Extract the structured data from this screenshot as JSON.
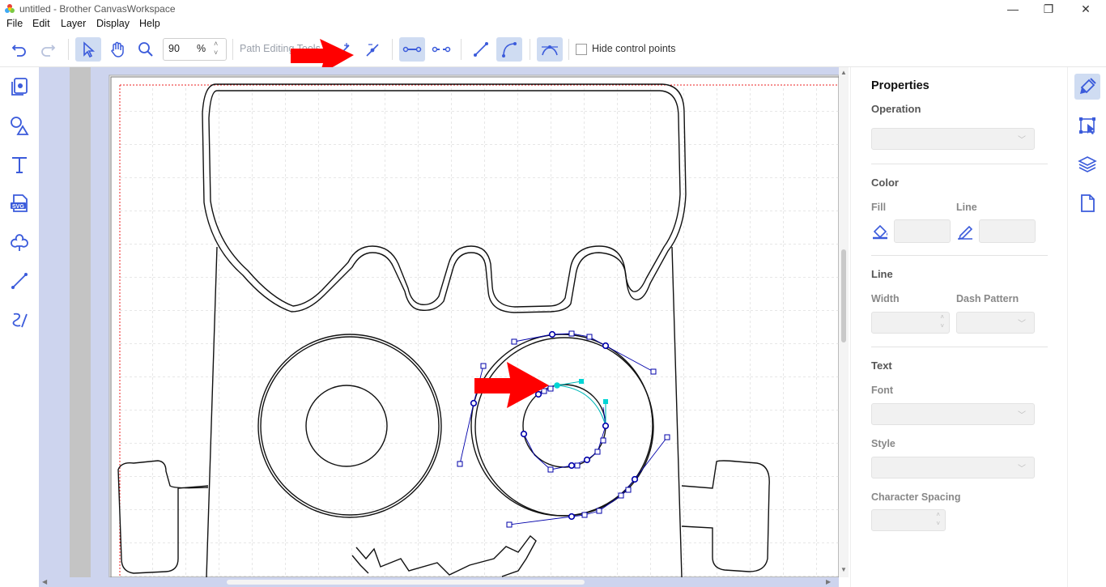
{
  "window": {
    "title": "untitled - Brother CanvasWorkspace",
    "minimize": "—",
    "restore": "❐",
    "close": "✕"
  },
  "menu": [
    "File",
    "Edit",
    "Layer",
    "Display",
    "Help"
  ],
  "toolbar": {
    "zoom_value": "90",
    "zoom_unit": "%",
    "path_tools_label": "Path Editing Tools",
    "hide_control_points": "Hide control points",
    "icons": [
      "undo-icon",
      "redo-icon",
      "select-pointer-icon",
      "hand-pan-icon",
      "zoom-icon",
      "add-node-icon",
      "delete-node-icon",
      "join-nodes-icon",
      "split-node-icon",
      "straight-segment-icon",
      "curve-segment-icon",
      "smooth-node-icon"
    ]
  },
  "left_tools": [
    "template-pages-icon",
    "shapes-icon",
    "text-icon",
    "svg-import-icon",
    "cut-shape-icon",
    "line-draw-icon",
    "freehand-draw-icon"
  ],
  "properties": {
    "title": "Properties",
    "operation_label": "Operation",
    "color_label": "Color",
    "fill_label": "Fill",
    "line_label": "Line",
    "line_section": "Line",
    "width_label": "Width",
    "dash_label": "Dash Pattern",
    "text_section": "Text",
    "font_label": "Font",
    "style_label": "Style",
    "spacing_label": "Character Spacing"
  },
  "right_icons": [
    "properties-brush-icon",
    "transform-icon",
    "layers-icon",
    "page-icon"
  ],
  "colors": {
    "accent": "#3b5bdb",
    "toolbar_active": "#cfdcf2",
    "canvas_bg": "#cdd4ee",
    "node_blue": "#0000aa",
    "node_cyan": "#00d5d5",
    "annotation_red": "#ff0000"
  }
}
